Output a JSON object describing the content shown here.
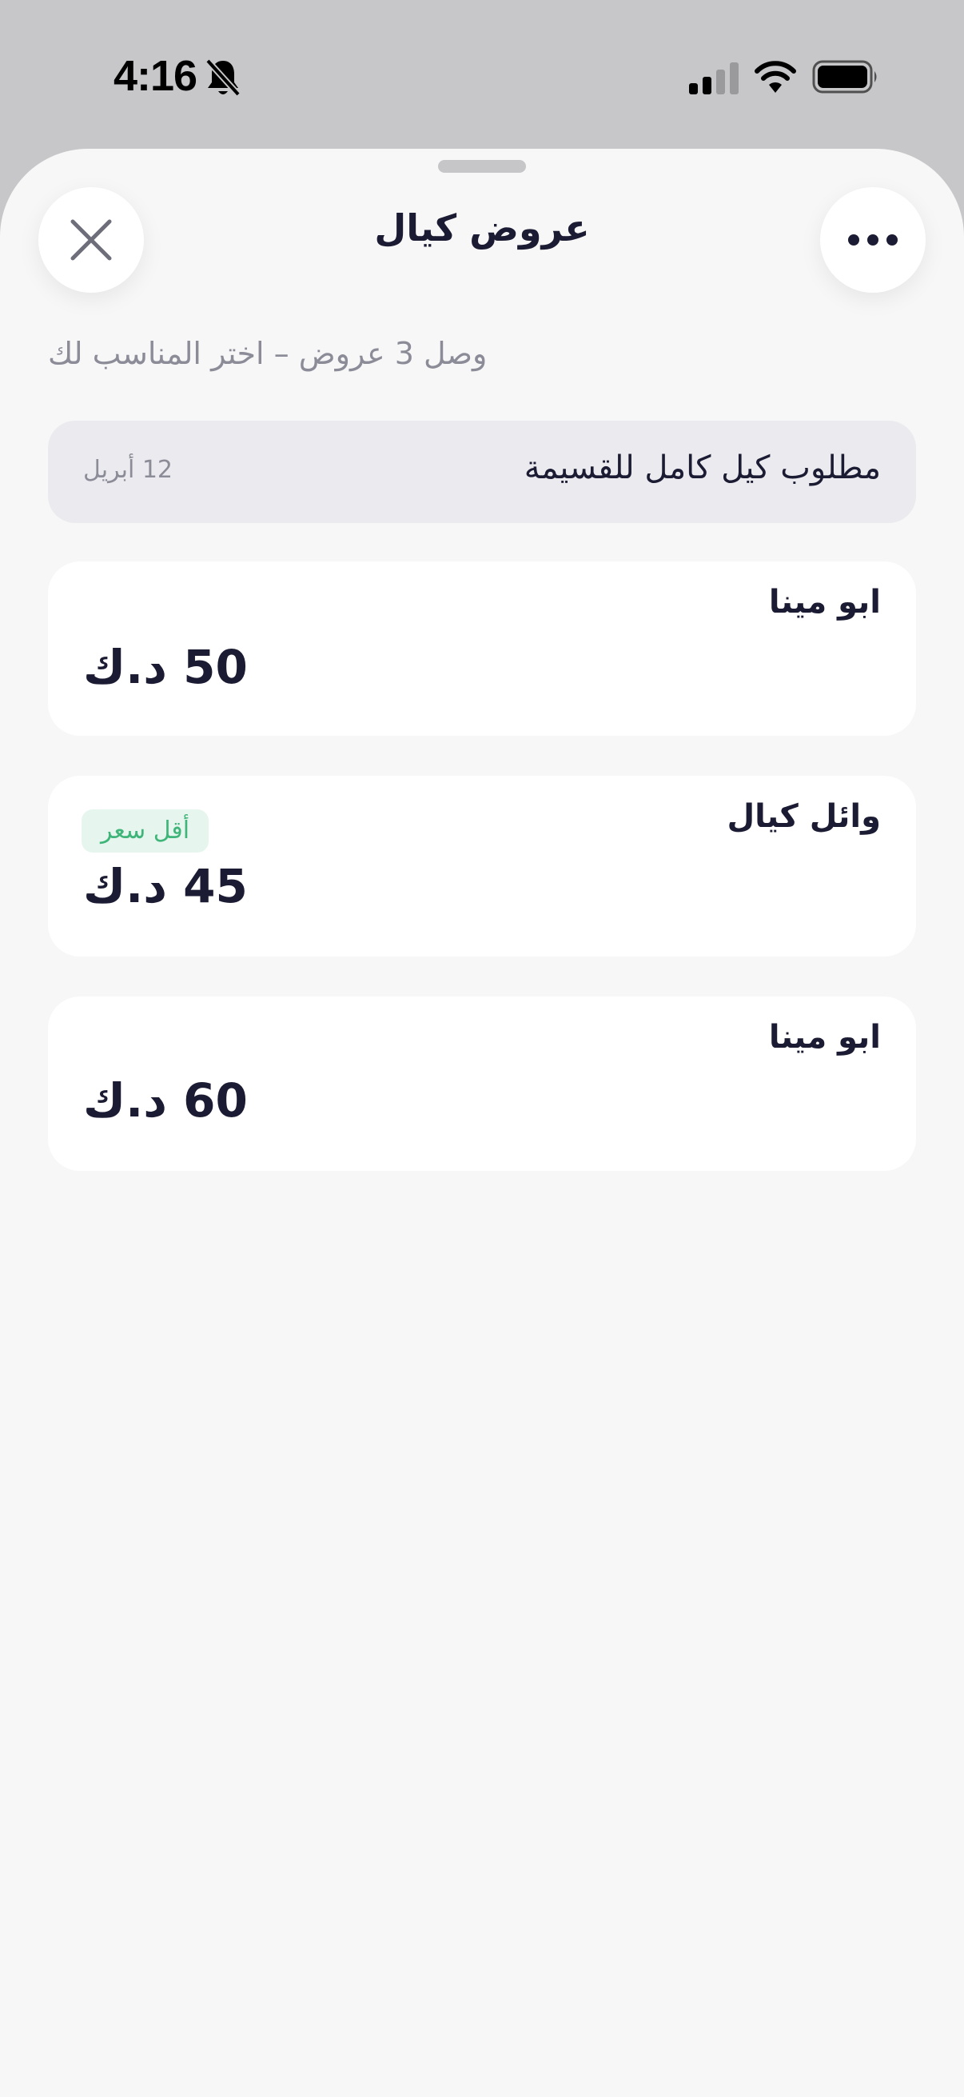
{
  "status_bar": {
    "time": "4:16"
  },
  "sheet": {
    "title": "عروض كيال",
    "subtitle": "وصل 3 عروض – اختر المناسب لك",
    "request": {
      "text": "مطلوب كيل كامل للقسيمة",
      "date": "12 أبريل"
    },
    "offers": [
      {
        "name": "ابو مينا",
        "price": "50 د.ك"
      },
      {
        "name": "وائل كيال",
        "price": "45 د.ك",
        "badge": "أقل سعر"
      },
      {
        "name": "ابو مينا",
        "price": "60 د.ك"
      }
    ]
  },
  "icons": {
    "close": "close-icon",
    "more": "more-icon",
    "bell_muted": "bell-slash-icon",
    "signal": "signal-icon",
    "wifi": "wifi-icon",
    "battery": "battery-icon"
  },
  "colors": {
    "title_text": "#1b1b33",
    "secondary_text": "#8c8c98",
    "badge_text": "#3fb57a",
    "badge_bg": "#e6f6ee"
  }
}
